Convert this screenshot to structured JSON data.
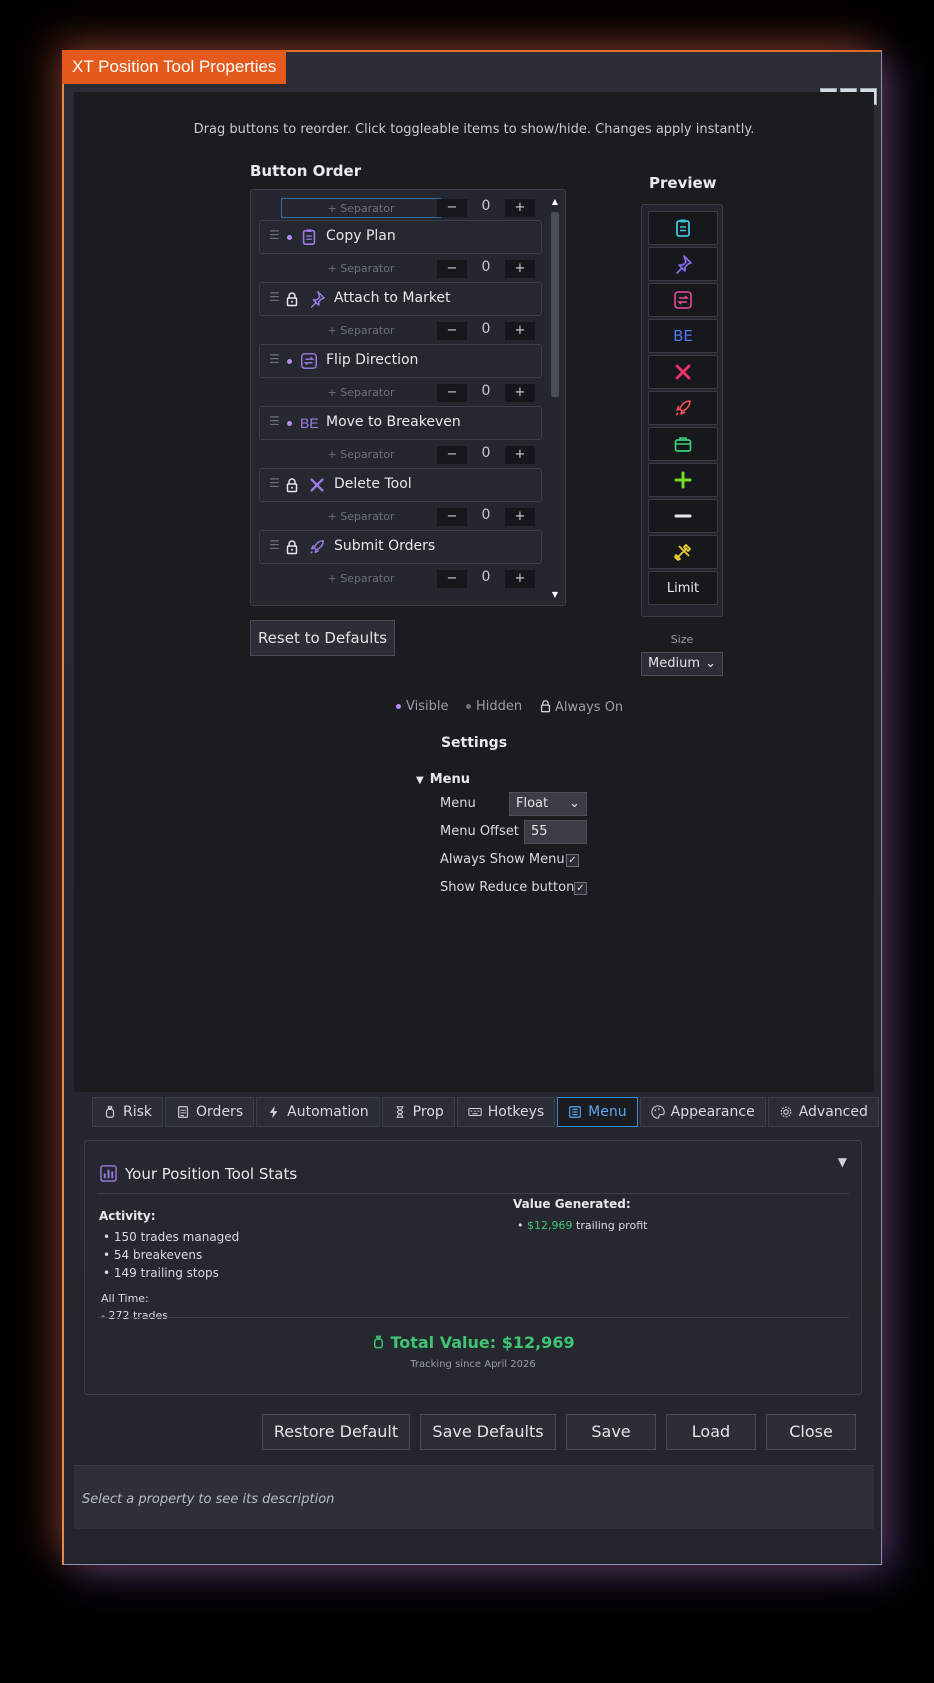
{
  "window": {
    "title": "XT Position Tool Properties",
    "minimize": "▁",
    "maximize": "□",
    "close": "✕"
  },
  "hint": "Drag buttons to reorder. Click toggleable items to show/hide. Changes apply instantly.",
  "button_order": {
    "title": "Button Order",
    "separator_label": "+ Separator",
    "minus": "−",
    "plus": "+",
    "separators": [
      "0",
      "0",
      "0",
      "0",
      "0",
      "0",
      "0"
    ],
    "items": [
      {
        "label": "Copy Plan",
        "state": "visible",
        "icon": "clipboard-icon",
        "color": "#a07ae6"
      },
      {
        "label": "Attach to Market",
        "state": "always-on",
        "icon": "pin-icon",
        "color": "#a07ae6"
      },
      {
        "label": "Flip Direction",
        "state": "visible",
        "icon": "flip-icon",
        "color": "#a07ae6"
      },
      {
        "label": "Move to Breakeven",
        "state": "visible",
        "icon": "be-icon",
        "glyph": "BE",
        "color": "#a07ae6"
      },
      {
        "label": "Delete Tool",
        "state": "always-on",
        "icon": "x-icon",
        "color": "#a07ae6"
      },
      {
        "label": "Submit Orders",
        "state": "always-on",
        "icon": "rocket-icon",
        "color": "#a07ae6"
      }
    ],
    "scroll_up": "▲",
    "scroll_down": "▼",
    "reset_label": "Reset to Defaults"
  },
  "preview": {
    "title": "Preview",
    "buttons": [
      {
        "icon": "clipboard-icon",
        "color": "#3ec6d8"
      },
      {
        "icon": "pin-icon",
        "color": "#8a6cf0"
      },
      {
        "icon": "flip-icon",
        "color": "#e84a9a"
      },
      {
        "icon": "be-icon",
        "text": "BE",
        "color": "#4f7af0"
      },
      {
        "icon": "x-icon",
        "color": "#f0306a"
      },
      {
        "icon": "rocket-icon",
        "color": "#f05050"
      },
      {
        "icon": "briefcase-icon",
        "color": "#3ad07a"
      },
      {
        "icon": "plus-icon",
        "color": "#6ee02a"
      },
      {
        "icon": "minus-icon",
        "color": "#e6e8ec"
      },
      {
        "icon": "tools-icon",
        "color": "#e8d030"
      },
      {
        "icon": "limit-icon",
        "text": "Limit",
        "color": "#e6e8ec"
      }
    ],
    "size_label": "Size",
    "size_value": "Medium"
  },
  "legend": {
    "visible": "Visible",
    "hidden": "Hidden",
    "always_on": "Always On",
    "visible_color": "#b78cf0",
    "hidden_color": "#6c7079"
  },
  "settings": {
    "title": "Settings",
    "group": "Menu",
    "group_toggle": "▼",
    "props": {
      "menu_label": "Menu",
      "menu_value": "Float",
      "offset_label": "Menu Offset",
      "offset_value": "55",
      "always_show_label": "Always Show Menu",
      "always_show_checked": "✓",
      "show_reduce_label": "Show Reduce button",
      "show_reduce_checked": "✓"
    }
  },
  "tabs": [
    {
      "label": "Risk",
      "icon": "money-bag-icon"
    },
    {
      "label": "Orders",
      "icon": "document-icon"
    },
    {
      "label": "Automation",
      "icon": "lightning-icon"
    },
    {
      "label": "Prop",
      "icon": "hourglass-icon"
    },
    {
      "label": "Hotkeys",
      "icon": "keyboard-icon"
    },
    {
      "label": "Menu",
      "icon": "menu-icon",
      "active": true
    },
    {
      "label": "Appearance",
      "icon": "palette-icon"
    },
    {
      "label": "Advanced",
      "icon": "gear-icon"
    }
  ],
  "stats": {
    "title": "Your Position Tool Stats",
    "collapse": "▼",
    "activity_title": "Activity:",
    "activity": [
      "150 trades managed",
      "54 breakevens",
      "149 trailing stops"
    ],
    "all_time_title": "All Time:",
    "all_time": [
      "- 272 trades"
    ],
    "value_title": "Value Generated:",
    "value_amount": "$12,969",
    "value_suffix": "trailing profit",
    "total_label": "Total Value: $12,969",
    "tracking": "Tracking since April 2026",
    "accent": "#40c476"
  },
  "footer": {
    "restore_default": "Restore Default",
    "save_defaults": "Save Defaults",
    "save": "Save",
    "load": "Load",
    "close": "Close"
  },
  "description": "Select a property to see its description"
}
